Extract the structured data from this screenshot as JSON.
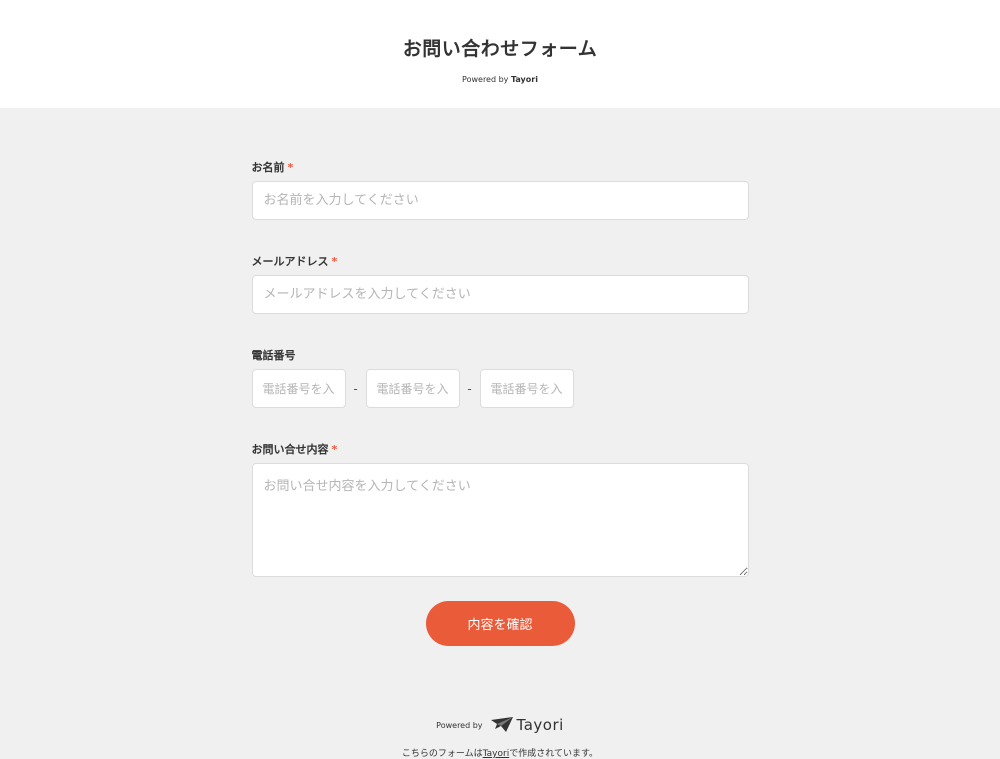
{
  "header": {
    "title": "お問い合わせフォーム",
    "powered_prefix": "Powered by",
    "powered_brand": "Tayori"
  },
  "form": {
    "name": {
      "label": "お名前",
      "required_mark": "*",
      "placeholder": "お名前を入力してください"
    },
    "email": {
      "label": "メールアドレス",
      "required_mark": "*",
      "placeholder": "メールアドレスを入力してください"
    },
    "phone": {
      "label": "電話番号",
      "placeholder": "電話番号を入力してください",
      "separator": "-"
    },
    "inquiry": {
      "label": "お問い合せ内容",
      "required_mark": "*",
      "placeholder": "お問い合せ内容を入力してください"
    },
    "submit_label": "内容を確認"
  },
  "footer": {
    "powered_prefix": "Powered by",
    "logo_text": "Tayori",
    "note_before": "こちらのフォームは",
    "note_link": "Tayori",
    "note_after": "で作成されています。"
  },
  "colors": {
    "accent": "#ea5b3a",
    "required": "#e9573c",
    "background": "#f0f0f0"
  }
}
